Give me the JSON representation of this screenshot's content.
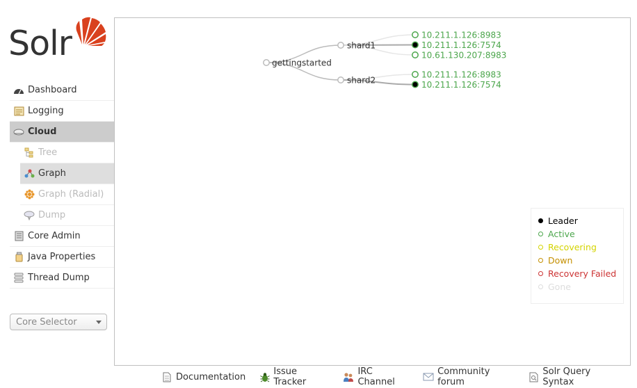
{
  "logo": {
    "text": "Solr"
  },
  "nav": {
    "items": [
      {
        "label": "Dashboard"
      },
      {
        "label": "Logging"
      },
      {
        "label": "Cloud"
      },
      {
        "label": "Core Admin"
      },
      {
        "label": "Java Properties"
      },
      {
        "label": "Thread Dump"
      }
    ],
    "cloud_sub": [
      {
        "label": "Tree"
      },
      {
        "label": "Graph"
      },
      {
        "label": "Graph (Radial)"
      },
      {
        "label": "Dump"
      }
    ],
    "core_selector": "Core Selector"
  },
  "graph": {
    "collection": "gettingstarted",
    "shards": [
      {
        "name": "shard1",
        "replicas": [
          {
            "address": "10.211.1.126:8983",
            "state": "active"
          },
          {
            "address": "10.211.1.126:7574",
            "state": "leader"
          },
          {
            "address": "10.61.130.207:8983",
            "state": "active"
          }
        ]
      },
      {
        "name": "shard2",
        "replicas": [
          {
            "address": "10.211.1.126:8983",
            "state": "active"
          },
          {
            "address": "10.211.1.126:7574",
            "state": "leader"
          }
        ]
      }
    ]
  },
  "legend": [
    {
      "label": "Leader",
      "color": "#000000",
      "filled": true
    },
    {
      "label": "Active",
      "color": "#4CA64C",
      "filled": false
    },
    {
      "label": "Recovering",
      "color": "#D4D400",
      "filled": false
    },
    {
      "label": "Down",
      "color": "#C48F00",
      "filled": false
    },
    {
      "label": "Recovery Failed",
      "color": "#CC3333",
      "filled": false
    },
    {
      "label": "Gone",
      "color": "#DDDDDD",
      "filled": false
    }
  ],
  "footer": [
    {
      "label": "Documentation",
      "icon": "document-icon"
    },
    {
      "label": "Issue Tracker",
      "icon": "bug-icon"
    },
    {
      "label": "IRC Channel",
      "icon": "people-icon"
    },
    {
      "label": "Community forum",
      "icon": "mail-icon"
    },
    {
      "label": "Solr Query Syntax",
      "icon": "query-icon"
    }
  ]
}
